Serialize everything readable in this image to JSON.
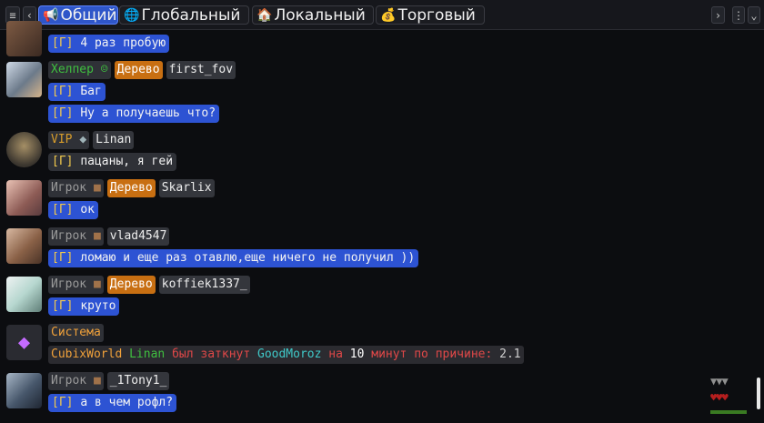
{
  "tabs": [
    {
      "label": "Общий",
      "icon": "megaphone-icon",
      "active": true
    },
    {
      "label": "Глобальный",
      "icon": "globe-icon",
      "active": false
    },
    {
      "label": "Локальный",
      "icon": "house-icon",
      "active": false
    },
    {
      "label": "Торговый",
      "icon": "money-bag-icon",
      "active": false
    }
  ],
  "channel_tag": "[Г]",
  "messages": [
    {
      "text": "4 раз пробую"
    },
    {
      "rank": "Хелпер",
      "role": "Дерево",
      "name": "first_fov",
      "lines": [
        "Баг",
        "Ну а получаешь что?"
      ]
    },
    {
      "rank": "VIP",
      "name": "Linan",
      "lines": [
        "пацаны, я гей"
      ]
    },
    {
      "rank": "Игрок",
      "role": "Дерево",
      "name": "Skarlix",
      "lines": [
        "ок"
      ]
    },
    {
      "rank": "Игрок",
      "name": "vlad4547",
      "lines": [
        "ломаю и еще раз отавлю,еще ничего не получил ))"
      ]
    },
    {
      "rank": "Игрок",
      "role": "Дерево",
      "name": "koffiek1337_",
      "lines": [
        "круто"
      ]
    },
    {
      "rank": "Система",
      "system": {
        "prefix": "CubixWorld",
        "target": "Linan",
        "verb": "был заткнут",
        "actor": "GoodMoroz",
        "on": "на",
        "amount": "10",
        "unit": "минут",
        "reason_label": "по причине:",
        "reason": "2.1"
      }
    },
    {
      "rank": "Игрок",
      "name": "_1Tony1_",
      "lines": [
        "а в чем рофл?"
      ]
    }
  ],
  "colors": {
    "accent": "#2f56c9",
    "bubble": "#2d53d3",
    "role": "#c86f12",
    "helper": "#3fbf3f",
    "vip": "#d79d2b",
    "system": "#f0a13a",
    "muted": "#9a9a9a"
  }
}
